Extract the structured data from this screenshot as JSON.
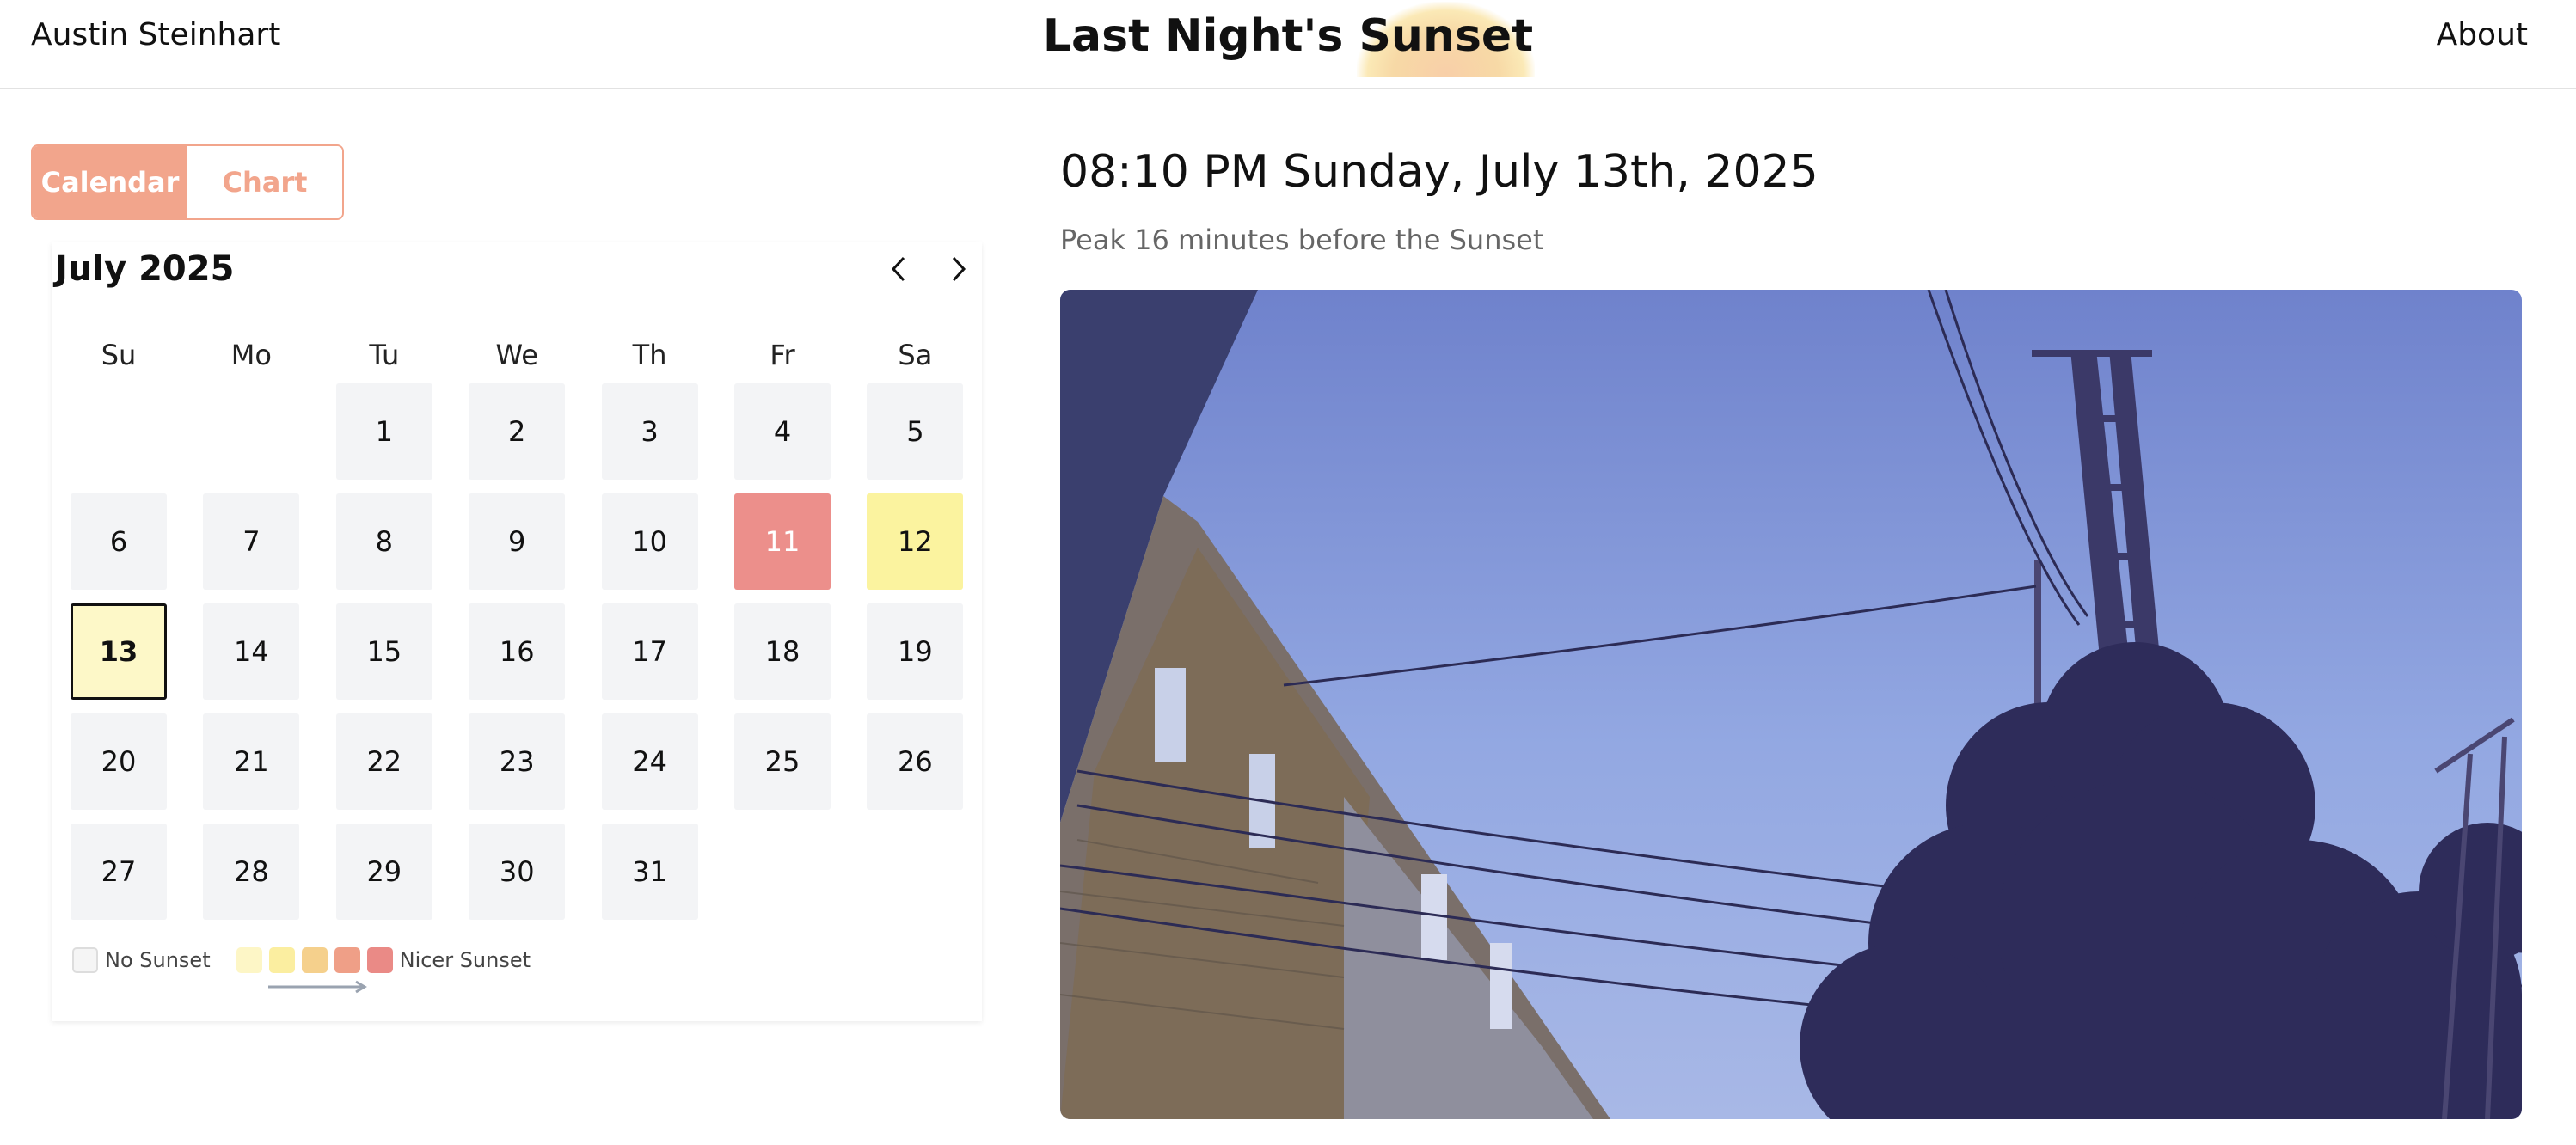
{
  "header": {
    "author": "Austin Steinhart",
    "title_prefix": "Last Night's ",
    "title_highlight": "Sunset",
    "about": "About"
  },
  "tabs": [
    {
      "label": "Calendar",
      "active": true
    },
    {
      "label": "Chart",
      "active": false
    }
  ],
  "calendar": {
    "month_label": "July 2025",
    "weekdays": [
      "Su",
      "Mo",
      "Tu",
      "We",
      "Th",
      "Fr",
      "Sa"
    ],
    "first_weekday_index": 2,
    "days": [
      {
        "label": "1"
      },
      {
        "label": "2"
      },
      {
        "label": "3"
      },
      {
        "label": "4"
      },
      {
        "label": "5"
      },
      {
        "label": "6"
      },
      {
        "label": "7"
      },
      {
        "label": "8"
      },
      {
        "label": "9"
      },
      {
        "label": "10"
      },
      {
        "label": "11",
        "rating": "nicest"
      },
      {
        "label": "12",
        "rating": "light"
      },
      {
        "label": "13",
        "rating": "lightest",
        "selected": true
      },
      {
        "label": "14"
      },
      {
        "label": "15"
      },
      {
        "label": "16"
      },
      {
        "label": "17"
      },
      {
        "label": "18"
      },
      {
        "label": "19"
      },
      {
        "label": "20"
      },
      {
        "label": "21"
      },
      {
        "label": "22"
      },
      {
        "label": "23"
      },
      {
        "label": "24"
      },
      {
        "label": "25"
      },
      {
        "label": "26"
      },
      {
        "label": "27"
      },
      {
        "label": "28"
      },
      {
        "label": "29"
      },
      {
        "label": "30"
      },
      {
        "label": "31"
      }
    ],
    "legend": {
      "no_sunset_label": "No Sunset",
      "nicer_label": "Nicer Sunset",
      "scale_colors": [
        "#fdf6c6",
        "#fbeea0",
        "#f5d08c",
        "#ef9f87",
        "#ea8a86"
      ]
    }
  },
  "colors": {
    "accent": "#f2a58c",
    "nicest_day": "#ec8f8b",
    "light_day": "#fbf39f",
    "selected_day": "#fdf8c8"
  },
  "detail": {
    "datetime": "08:10 PM Sunday, July 13th, 2025",
    "peak": "Peak 16 minutes before the Sunset"
  }
}
